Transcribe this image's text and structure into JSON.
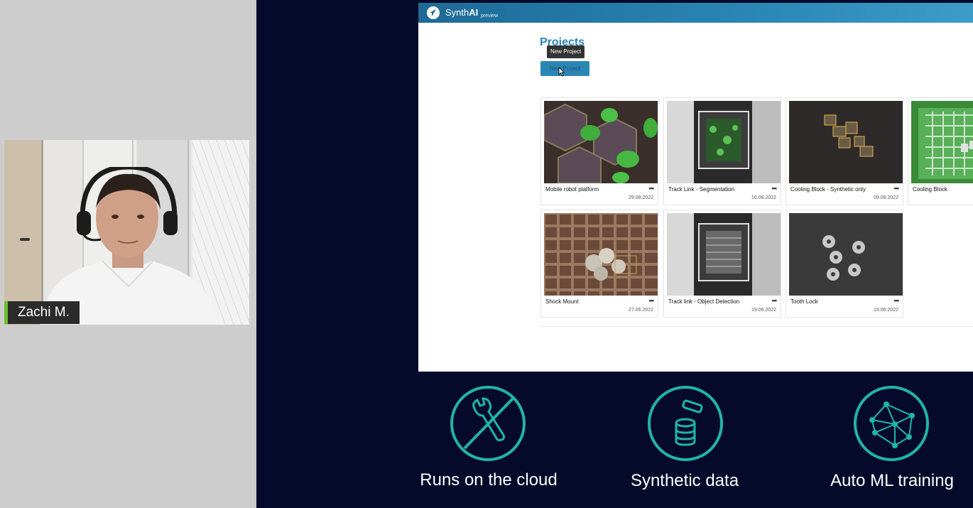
{
  "participant": {
    "name": "Zachi M.",
    "accent_color": "#6abf2e"
  },
  "app": {
    "brand_regular": "Synth",
    "brand_bold": "AI",
    "brand_suffix": "preview",
    "header_color": "#2a86b5",
    "page_title": "Projects",
    "tooltip": "New Project",
    "new_project_label": "New Project",
    "projects": [
      {
        "name": "Mobile robot platform",
        "date": "29.08.2022",
        "menu": "•••"
      },
      {
        "name": "Track Link - Segmentation",
        "date": "10.08.2022",
        "menu": "•••"
      },
      {
        "name": "Cooling Block - Synthetic only",
        "date": "09.08.2022",
        "menu": "•••"
      },
      {
        "name": "Cooling Block",
        "date": "",
        "menu": ""
      },
      {
        "name": "Shock Mount",
        "date": "27.06.2022",
        "menu": "•••"
      },
      {
        "name": "Track link - Object Detection",
        "date": "19.06.2022",
        "menu": "•••"
      },
      {
        "name": "Tooth Lock",
        "date": "19.06.2022",
        "menu": "•••"
      }
    ]
  },
  "features": [
    {
      "label": "Runs on the cloud",
      "icon": "no-wrench-icon"
    },
    {
      "label": "Synthetic data",
      "icon": "database-icon"
    },
    {
      "label": "Auto ML training",
      "icon": "neural-network-icon"
    }
  ],
  "colors": {
    "stage_background": "#060a2a",
    "feature_accent": "#1fb5a7"
  }
}
